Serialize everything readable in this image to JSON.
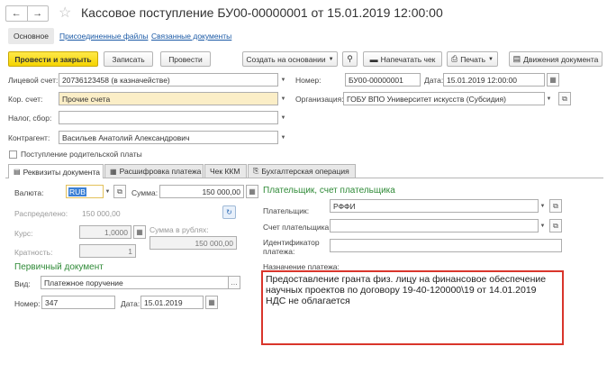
{
  "window": {
    "title": "Кассовое поступление БУ00-00000001 от 15.01.2019 12:00:00"
  },
  "nav_tabs": {
    "main": "Основное",
    "files": "Присоединенные файлы",
    "linked": "Связанные документы"
  },
  "toolbar": {
    "post_close": "Провести и закрыть",
    "save": "Записать",
    "post": "Провести",
    "create_based": "Создать на основании",
    "print_receipt": "Напечатать чек",
    "print": "Печать",
    "movements": "Движения документа"
  },
  "header": {
    "personal_account_label": "Лицевой счет:",
    "personal_account_value": "20736123458 (в казначействе)",
    "number_label": "Номер:",
    "number_value": "БУ00-00000001",
    "date_label": "Дата:",
    "date_value": "15.01.2019 12:00:00",
    "corr_account_label": "Кор. счет:",
    "corr_account_value": "Прочие счета",
    "org_label": "Организация:",
    "org_value": "ГОБУ ВПО Университет искусств (Субсидия)",
    "tax_label": "Налог, сбор:",
    "tax_value": "",
    "contractor_label": "Контрагент:",
    "contractor_value": "Васильев Анатолий Александрович",
    "parent_payment_label": "Поступление родительской платы"
  },
  "content_tabs": {
    "requisites": "Реквизиты документа",
    "breakdown": "Расшифровка платежа",
    "kkm": "Чек ККМ",
    "accounting": "Бухгалтерская операция"
  },
  "requisites": {
    "currency_label": "Валюта:",
    "currency_value": "RUB",
    "sum_label": "Сумма:",
    "sum_value": "150 000,00",
    "distributed_label": "Распределено:",
    "distributed_value": "150 000,00",
    "rate_label": "Курс:",
    "rate_value": "1,0000",
    "sum_rub_label": "Сумма в рублях:",
    "sum_rub_value": "150 000,00",
    "multiplicity_label": "Кратность:",
    "multiplicity_value": "1",
    "primary_doc_title": "Первичный документ",
    "kind_label": "Вид:",
    "kind_value": "Платежное поручение",
    "doc_number_label": "Номер:",
    "doc_number_value": "347",
    "doc_date_label": "Дата:",
    "doc_date_value": "15.01.2019"
  },
  "payer": {
    "section_title": "Плательщик, счет плательщика",
    "payer_label": "Плательщик:",
    "payer_value": "РФФИ",
    "account_label": "Счет плательщика:",
    "account_value": "",
    "identifier_label_1": "Идентификатор",
    "identifier_label_2": "платежа:",
    "identifier_value": "",
    "purpose_label": "Назначение платежа:",
    "purpose_line_1": "Предоставление гранта физ. лицу на финансовое обеспечение",
    "purpose_line_2": "научных проектов по договору 19-40-120000\\19 от 14.01.2019",
    "purpose_line_3": "НДС не облагается"
  },
  "colors": {
    "accent_green": "#2f8a37",
    "highlight_red": "#d9352b",
    "primary_yellow": "#f5d400",
    "link_blue": "#1b5aa6"
  }
}
